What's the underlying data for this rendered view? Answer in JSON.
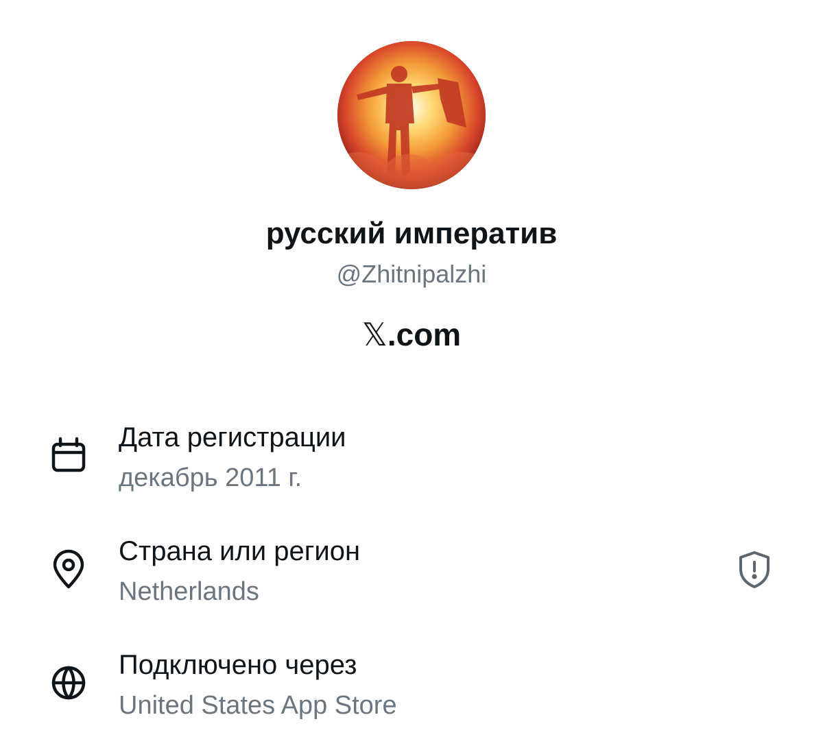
{
  "profile": {
    "display_name": "русский императив",
    "handle": "@Zhitnipalzhi",
    "source_mark": "𝕏",
    "source_suffix": ".com",
    "avatar": "avatar-figure-in-fire"
  },
  "about": {
    "rows": [
      {
        "icon": "calendar-icon",
        "title": "Дата регистрации",
        "value": "декабрь 2011 г."
      },
      {
        "icon": "location-pin-icon",
        "title": "Страна или регион",
        "value": "Netherlands",
        "trailing_icon": "shield-alert-icon"
      },
      {
        "icon": "globe-icon",
        "title": "Подключено через",
        "value": "United States App Store"
      }
    ]
  },
  "colors": {
    "primary_text": "#0f1419",
    "secondary_text": "#6b7580",
    "background": "#ffffff"
  }
}
